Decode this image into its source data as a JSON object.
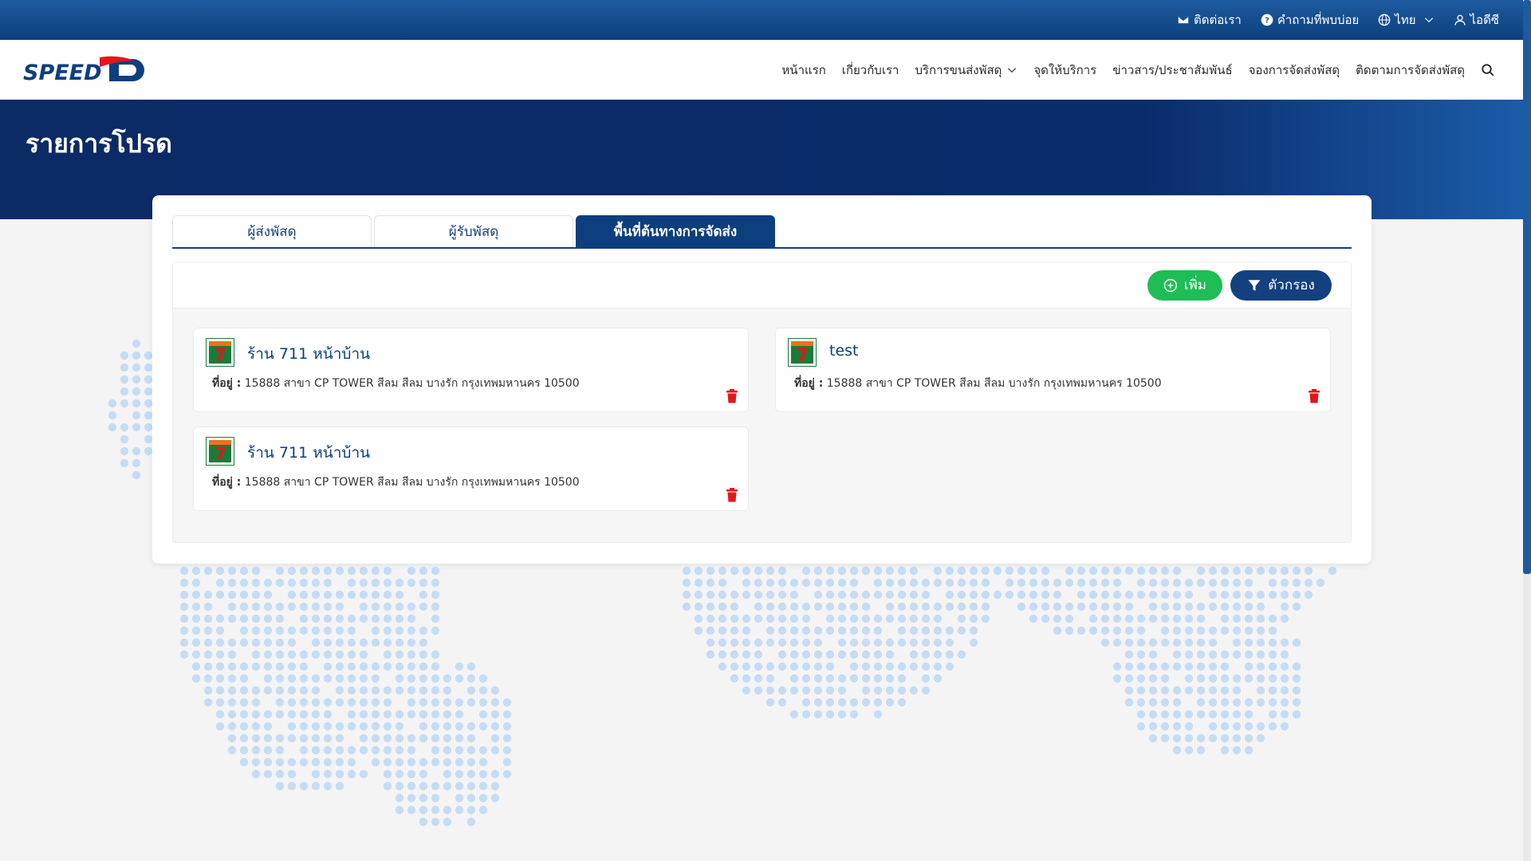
{
  "topbar": {
    "contact": "ติดต่อเรา",
    "faq": "คำถามที่พบบ่อย",
    "language": "ไทย",
    "user": "ไอดีซี"
  },
  "brand": {
    "logo_text": "SPEED"
  },
  "nav": {
    "items": [
      {
        "label": "หน้าแรก"
      },
      {
        "label": "เกี่ยวกับเรา"
      },
      {
        "label": "บริการขนส่งพัสดุ"
      },
      {
        "label": "จุดให้บริการ"
      },
      {
        "label": "ข่าวสาร/ประชาสัมพันธ์"
      },
      {
        "label": "จองการจัดส่งพัสดุ"
      },
      {
        "label": "ติดตามการจัดส่งพัสดุ"
      }
    ]
  },
  "hero": {
    "title": "รายการโปรด"
  },
  "tabs": [
    {
      "label": "ผู้ส่งพัสดุ"
    },
    {
      "label": "ผู้รับพัสดุ"
    },
    {
      "label": "พื้นที่ต้นทางการจัดส่ง"
    }
  ],
  "actions": {
    "add": "เพิ่ม",
    "filter": "ตัวกรอง"
  },
  "address_label": "ที่อยู่ :",
  "favorites": [
    {
      "name": "ร้าน 711 หน้าบ้าน",
      "address": "15888 สาขา CP TOWER สีลม สีลม บางรัก กรุงเทพมหานคร 10500"
    },
    {
      "name": "test",
      "address": "15888 สาขา CP TOWER สีลม สีลม บางรัก กรุงเทพมหานคร 10500"
    },
    {
      "name": "ร้าน 711 หน้าบ้าน",
      "address": "15888 สาขา CP TOWER สีลม สีลม บางรัก กรุงเทพมหานคร 10500"
    }
  ],
  "colors": {
    "primary": "#0d3f7e",
    "add": "#1ebd55",
    "delete": "#e3161b",
    "map_dot": "#c6dcf3"
  }
}
